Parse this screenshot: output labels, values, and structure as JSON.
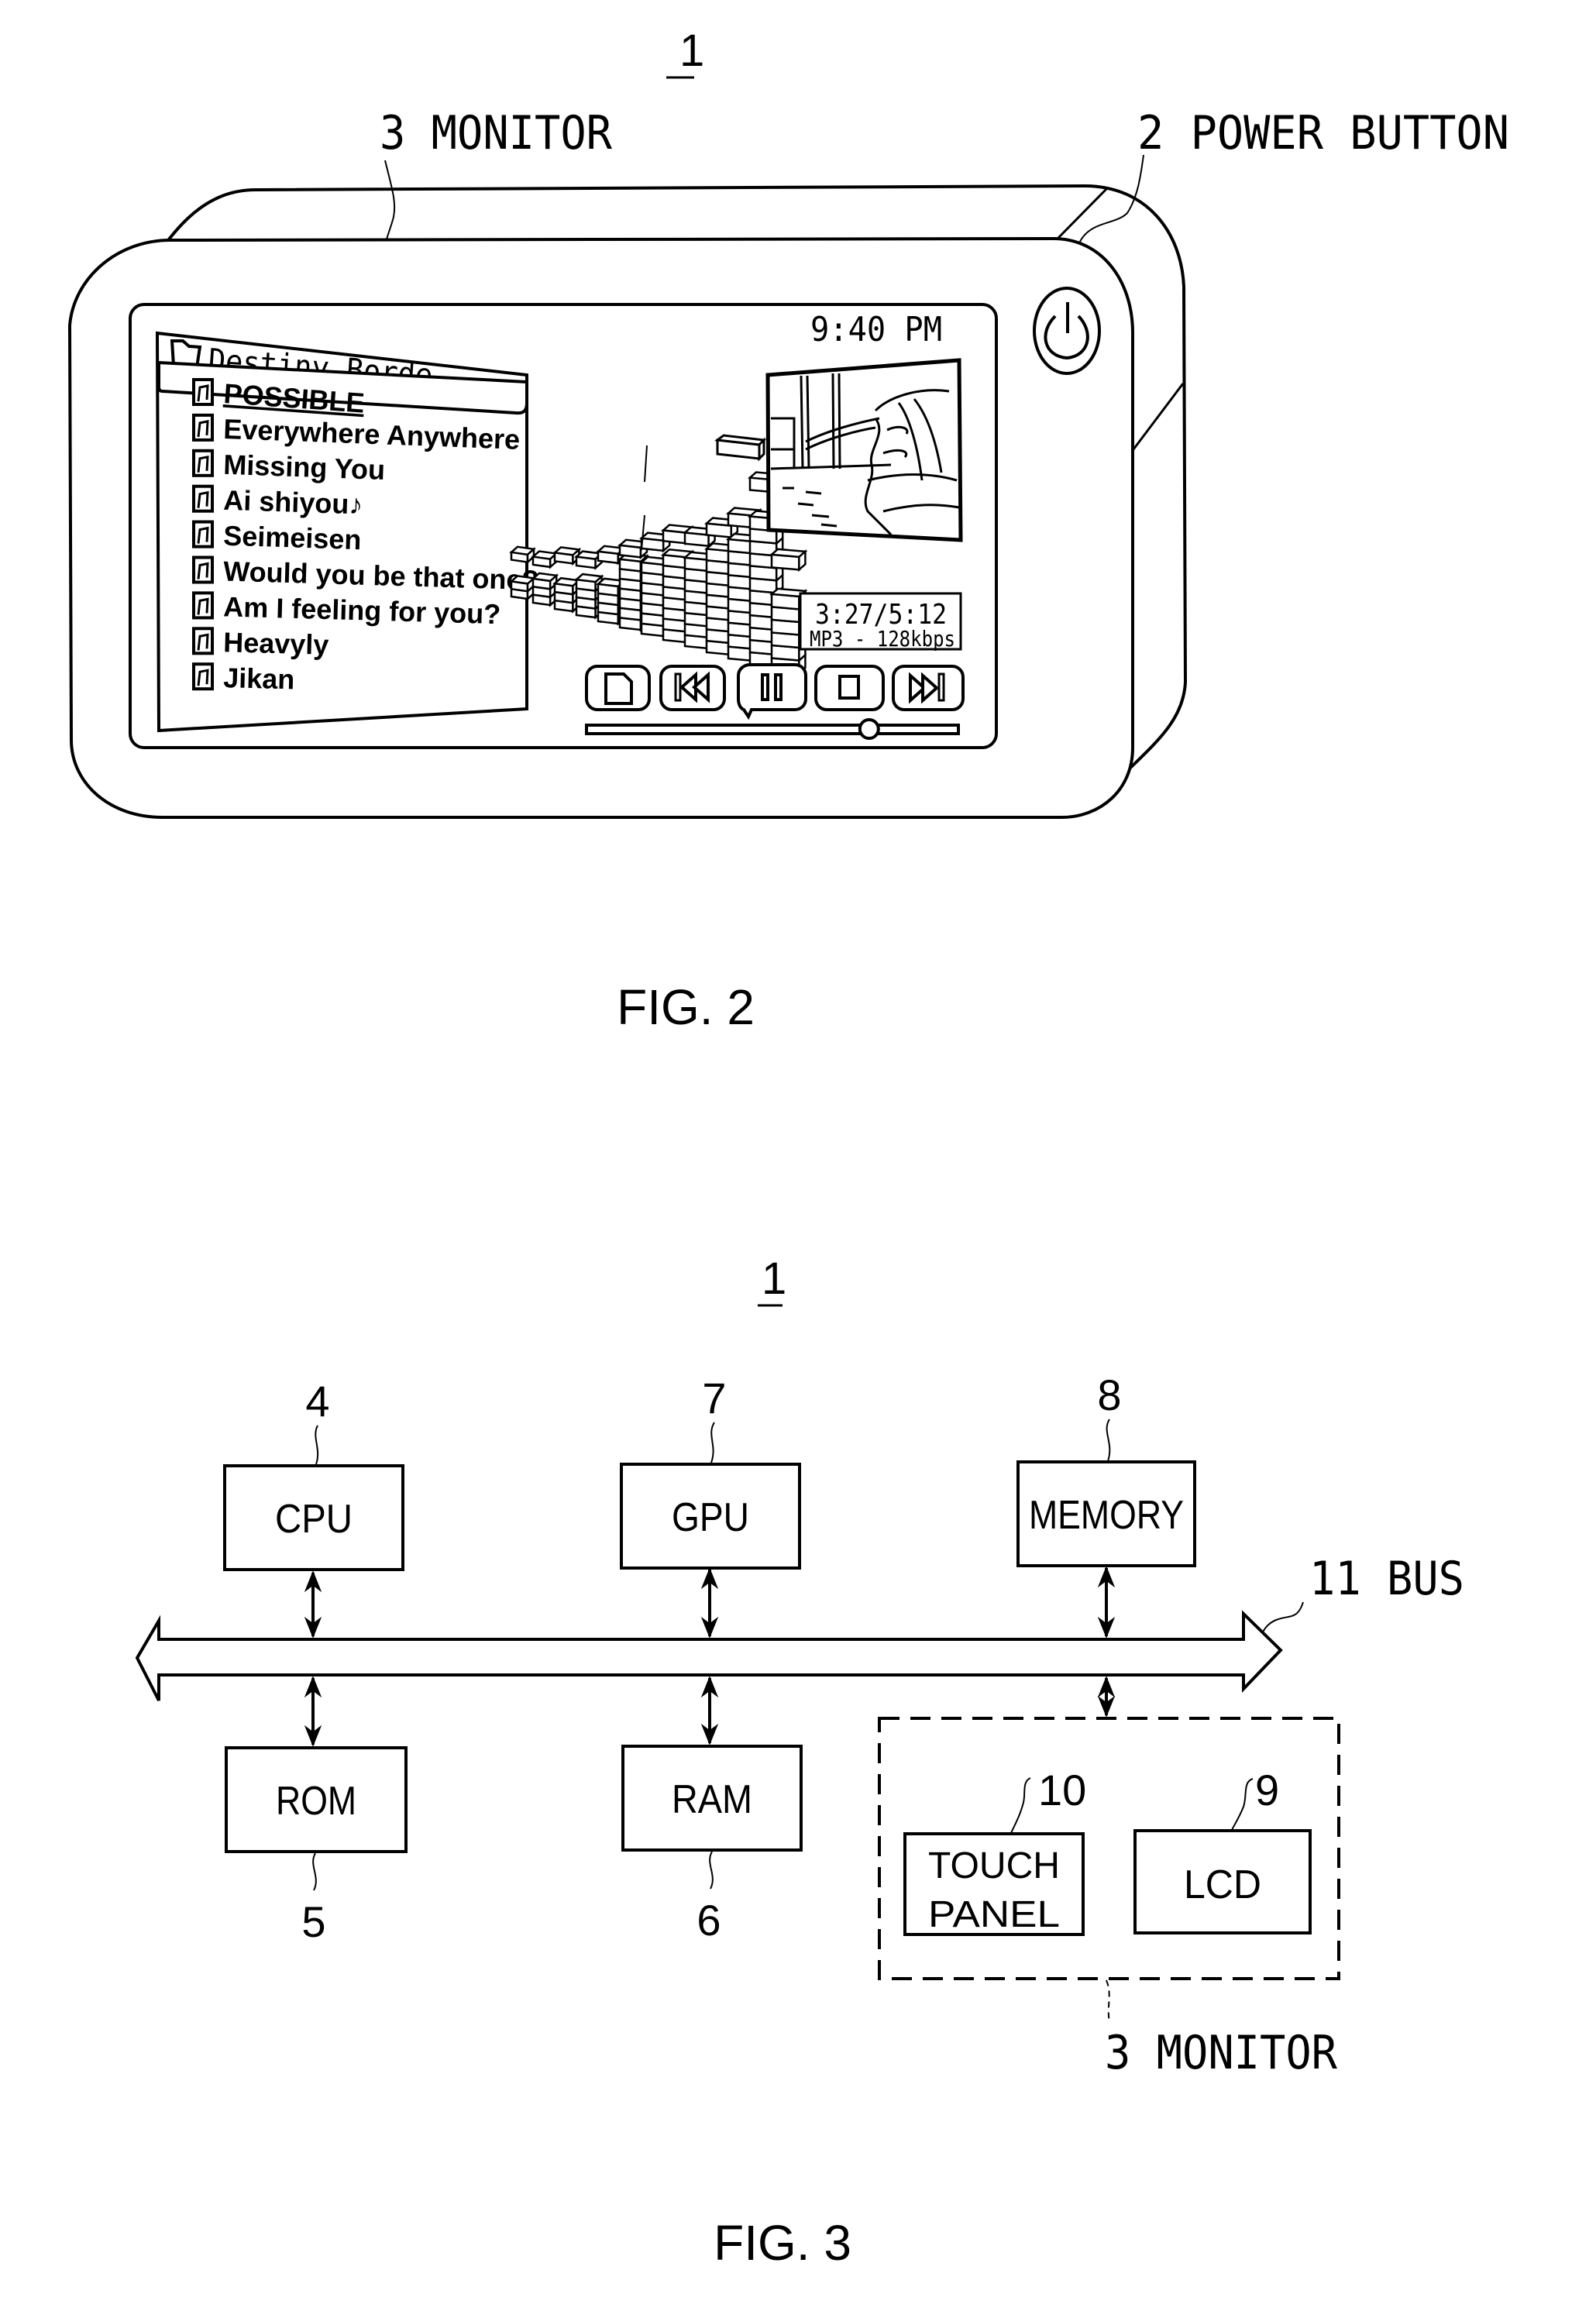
{
  "fig2": {
    "ref_number": "1",
    "caption": "FIG. 2",
    "callouts": {
      "monitor": "3 MONITOR",
      "power_button": "2 POWER BUTTON"
    },
    "screen": {
      "clock": "9:40 PM",
      "playlist": {
        "folder_icon": "folder-music-icon",
        "album_title": "Destiny Borde",
        "selected_index": 0,
        "track_icon": "music-note-icon",
        "tracks": [
          "POSSIBLE",
          "Everywhere Anywhere",
          "Missing You",
          "Ai shiyou♪",
          "Seimeisen",
          "Would you be that one?",
          "Am I feeling for you?",
          "Heavyly",
          "Jikan"
        ]
      },
      "visualizer": {
        "icon": "spectrum-visualizer",
        "levels": [
          2,
          3,
          3,
          4,
          4,
          7,
          7,
          8,
          8,
          9,
          10,
          12,
          6
        ],
        "peaks": [
          4,
          4,
          5,
          5,
          6,
          7,
          8,
          9,
          9,
          10,
          11,
          14,
          8
        ]
      },
      "video_thumbnail": "video-frame",
      "time_display": {
        "elapsed_total": "3:27/5:12",
        "format": "MP3 - 128kbps"
      },
      "controls": [
        {
          "name": "file",
          "icon": "document-icon"
        },
        {
          "name": "previous",
          "icon": "skip-back-icon"
        },
        {
          "name": "pause",
          "icon": "pause-icon"
        },
        {
          "name": "stop",
          "icon": "stop-icon"
        },
        {
          "name": "next",
          "icon": "skip-forward-icon"
        }
      ],
      "seek_progress": 0.76
    }
  },
  "fig3": {
    "ref_number": "1",
    "caption": "FIG. 3",
    "blocks": {
      "cpu": {
        "label": "CPU",
        "ref": "4"
      },
      "gpu": {
        "label": "GPU",
        "ref": "7"
      },
      "memory": {
        "label": "MEMORY",
        "ref": "8"
      },
      "rom": {
        "label": "ROM",
        "ref": "5"
      },
      "ram": {
        "label": "RAM",
        "ref": "6"
      },
      "touch_panel": {
        "label_line1": "TOUCH",
        "label_line2": "PANEL",
        "ref": "10"
      },
      "lcd": {
        "label": "LCD",
        "ref": "9"
      }
    },
    "bus_label": "11 BUS",
    "monitor_label": "3 MONITOR",
    "connections": [
      [
        "cpu",
        "bus"
      ],
      [
        "gpu",
        "bus"
      ],
      [
        "memory",
        "bus"
      ],
      [
        "rom",
        "bus"
      ],
      [
        "ram",
        "bus"
      ],
      [
        "monitor",
        "bus"
      ]
    ]
  }
}
